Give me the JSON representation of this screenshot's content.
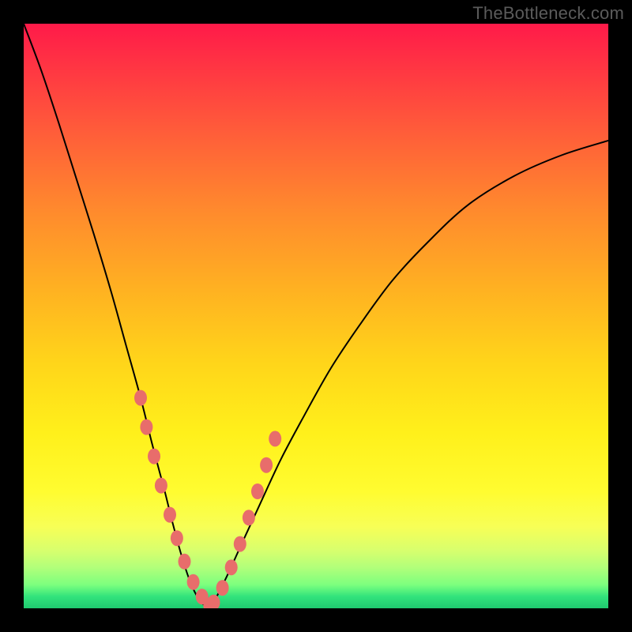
{
  "watermark": "TheBottleneck.com",
  "colors": {
    "frame": "#000000",
    "curve": "#000000",
    "bead": "#e86d6b"
  },
  "chart_data": {
    "type": "line",
    "title": "",
    "xlabel": "",
    "ylabel": "",
    "xlim": [
      0,
      1
    ],
    "ylim": [
      0,
      1
    ],
    "grid": false,
    "note": "Stylized bottleneck curve over a vertical red→yellow→green gradient. The curve reaches its minimum (y≈0) near x≈0.28…0.34. Left branch starts near the top-left corner and descends steeply; right branch rises and exits the right edge around y≈0.80. Salmon-colored beads are clustered on both branches near the minimum.",
    "series": [
      {
        "name": "left-branch",
        "x": [
          0.0,
          0.03,
          0.06,
          0.09,
          0.12,
          0.15,
          0.175,
          0.2,
          0.22,
          0.24,
          0.255,
          0.27,
          0.285,
          0.3,
          0.315
        ],
        "y": [
          1.0,
          0.92,
          0.83,
          0.735,
          0.64,
          0.54,
          0.45,
          0.36,
          0.28,
          0.205,
          0.145,
          0.09,
          0.045,
          0.015,
          0.0
        ]
      },
      {
        "name": "right-branch",
        "x": [
          0.315,
          0.33,
          0.35,
          0.375,
          0.405,
          0.44,
          0.48,
          0.525,
          0.575,
          0.63,
          0.69,
          0.76,
          0.84,
          0.92,
          1.0
        ],
        "y": [
          0.0,
          0.02,
          0.06,
          0.115,
          0.18,
          0.255,
          0.33,
          0.41,
          0.485,
          0.56,
          0.625,
          0.69,
          0.74,
          0.775,
          0.8
        ]
      }
    ],
    "beads_left": {
      "x": [
        0.2,
        0.21,
        0.223,
        0.235,
        0.25,
        0.262,
        0.275,
        0.29,
        0.305,
        0.318
      ],
      "y": [
        0.36,
        0.31,
        0.26,
        0.21,
        0.16,
        0.12,
        0.08,
        0.045,
        0.02,
        0.005
      ]
    },
    "beads_right": {
      "x": [
        0.325,
        0.34,
        0.355,
        0.37,
        0.385,
        0.4,
        0.415,
        0.43
      ],
      "y": [
        0.01,
        0.035,
        0.07,
        0.11,
        0.155,
        0.2,
        0.245,
        0.29
      ]
    }
  }
}
